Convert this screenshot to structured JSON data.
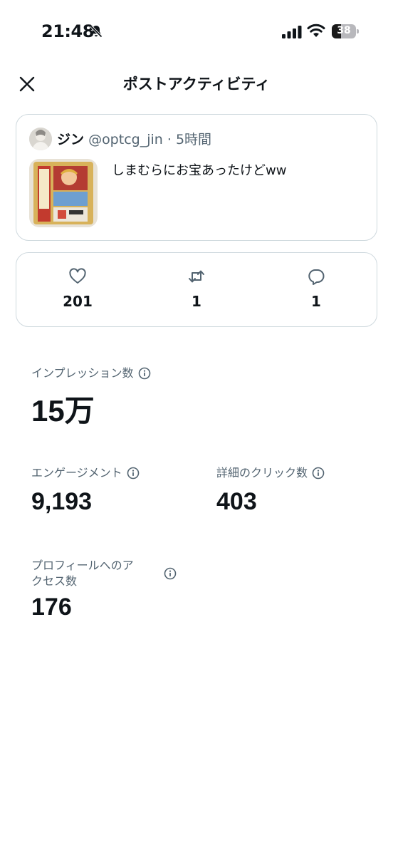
{
  "status_bar": {
    "time": "21:48",
    "battery": "38",
    "battery_level": 0.38
  },
  "header": {
    "title": "ポストアクティビティ"
  },
  "post": {
    "author_name": "ジン",
    "author_handle": "@optcg_jin",
    "separator": "·",
    "time": "5時間",
    "text": "しまむらにお宝あったけどww"
  },
  "engagement": {
    "likes": "201",
    "reposts": "1",
    "replies": "1"
  },
  "metrics": {
    "impressions": {
      "label": "インプレッション数",
      "value": "15万"
    },
    "engagements": {
      "label": "エンゲージメント",
      "value": "9,193"
    },
    "detail_clicks": {
      "label": "詳細のクリック数",
      "value": "403"
    },
    "profile_visits": {
      "label_line1": "プロフィールへのア",
      "label_line2": "クセス数",
      "value": "176"
    }
  },
  "colors": {
    "text": "#0f1419",
    "secondary": "#536471",
    "border": "#cfd9de"
  },
  "icons": [
    "bell-slash-icon",
    "signal-icon",
    "wifi-icon",
    "close-icon",
    "heart-icon",
    "repost-icon",
    "reply-icon",
    "info-icon"
  ]
}
